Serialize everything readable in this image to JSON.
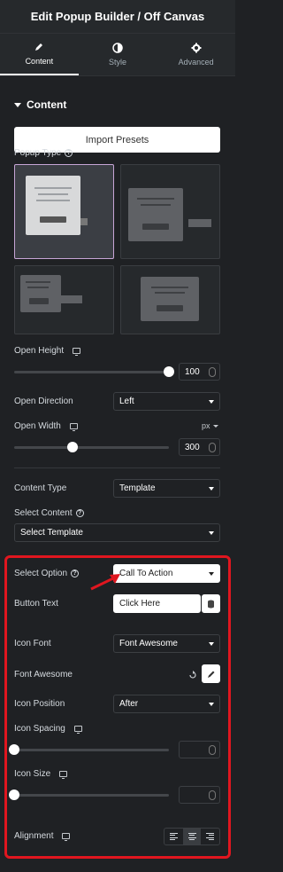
{
  "header": {
    "title": "Edit Popup Builder / Off Canvas"
  },
  "tabs": [
    {
      "label": "Content"
    },
    {
      "label": "Style"
    },
    {
      "label": "Advanced"
    }
  ],
  "section": {
    "title": "Content"
  },
  "import_button": "Import Presets",
  "popup_type": {
    "label": "Popup Type",
    "selected_index": 0
  },
  "open_height": {
    "label": "Open Height",
    "value": "100",
    "slider_fraction": 1.0
  },
  "open_direction": {
    "label": "Open Direction",
    "value": "Left"
  },
  "open_width": {
    "label": "Open Width",
    "unit": "px",
    "value": "300",
    "slider_fraction": 0.38
  },
  "content_type": {
    "label": "Content Type",
    "value": "Template"
  },
  "select_content": {
    "label": "Select Content",
    "value": "Select Template"
  },
  "select_option": {
    "label": "Select Option",
    "value": "Call To Action"
  },
  "button_text": {
    "label": "Button Text",
    "value": "Click Here"
  },
  "icon_font": {
    "label": "Icon Font",
    "value": "Font Awesome"
  },
  "font_awesome": {
    "label": "Font Awesome"
  },
  "icon_position": {
    "label": "Icon Position",
    "value": "After"
  },
  "icon_spacing": {
    "label": "Icon Spacing",
    "value": "",
    "slider_fraction": 0
  },
  "icon_size": {
    "label": "Icon Size",
    "value": "",
    "slider_fraction": 0
  },
  "alignment": {
    "label": "Alignment",
    "selected": "center"
  },
  "colors": {
    "highlight": "#e0161f",
    "selected_tile": "#c7a5d6"
  }
}
